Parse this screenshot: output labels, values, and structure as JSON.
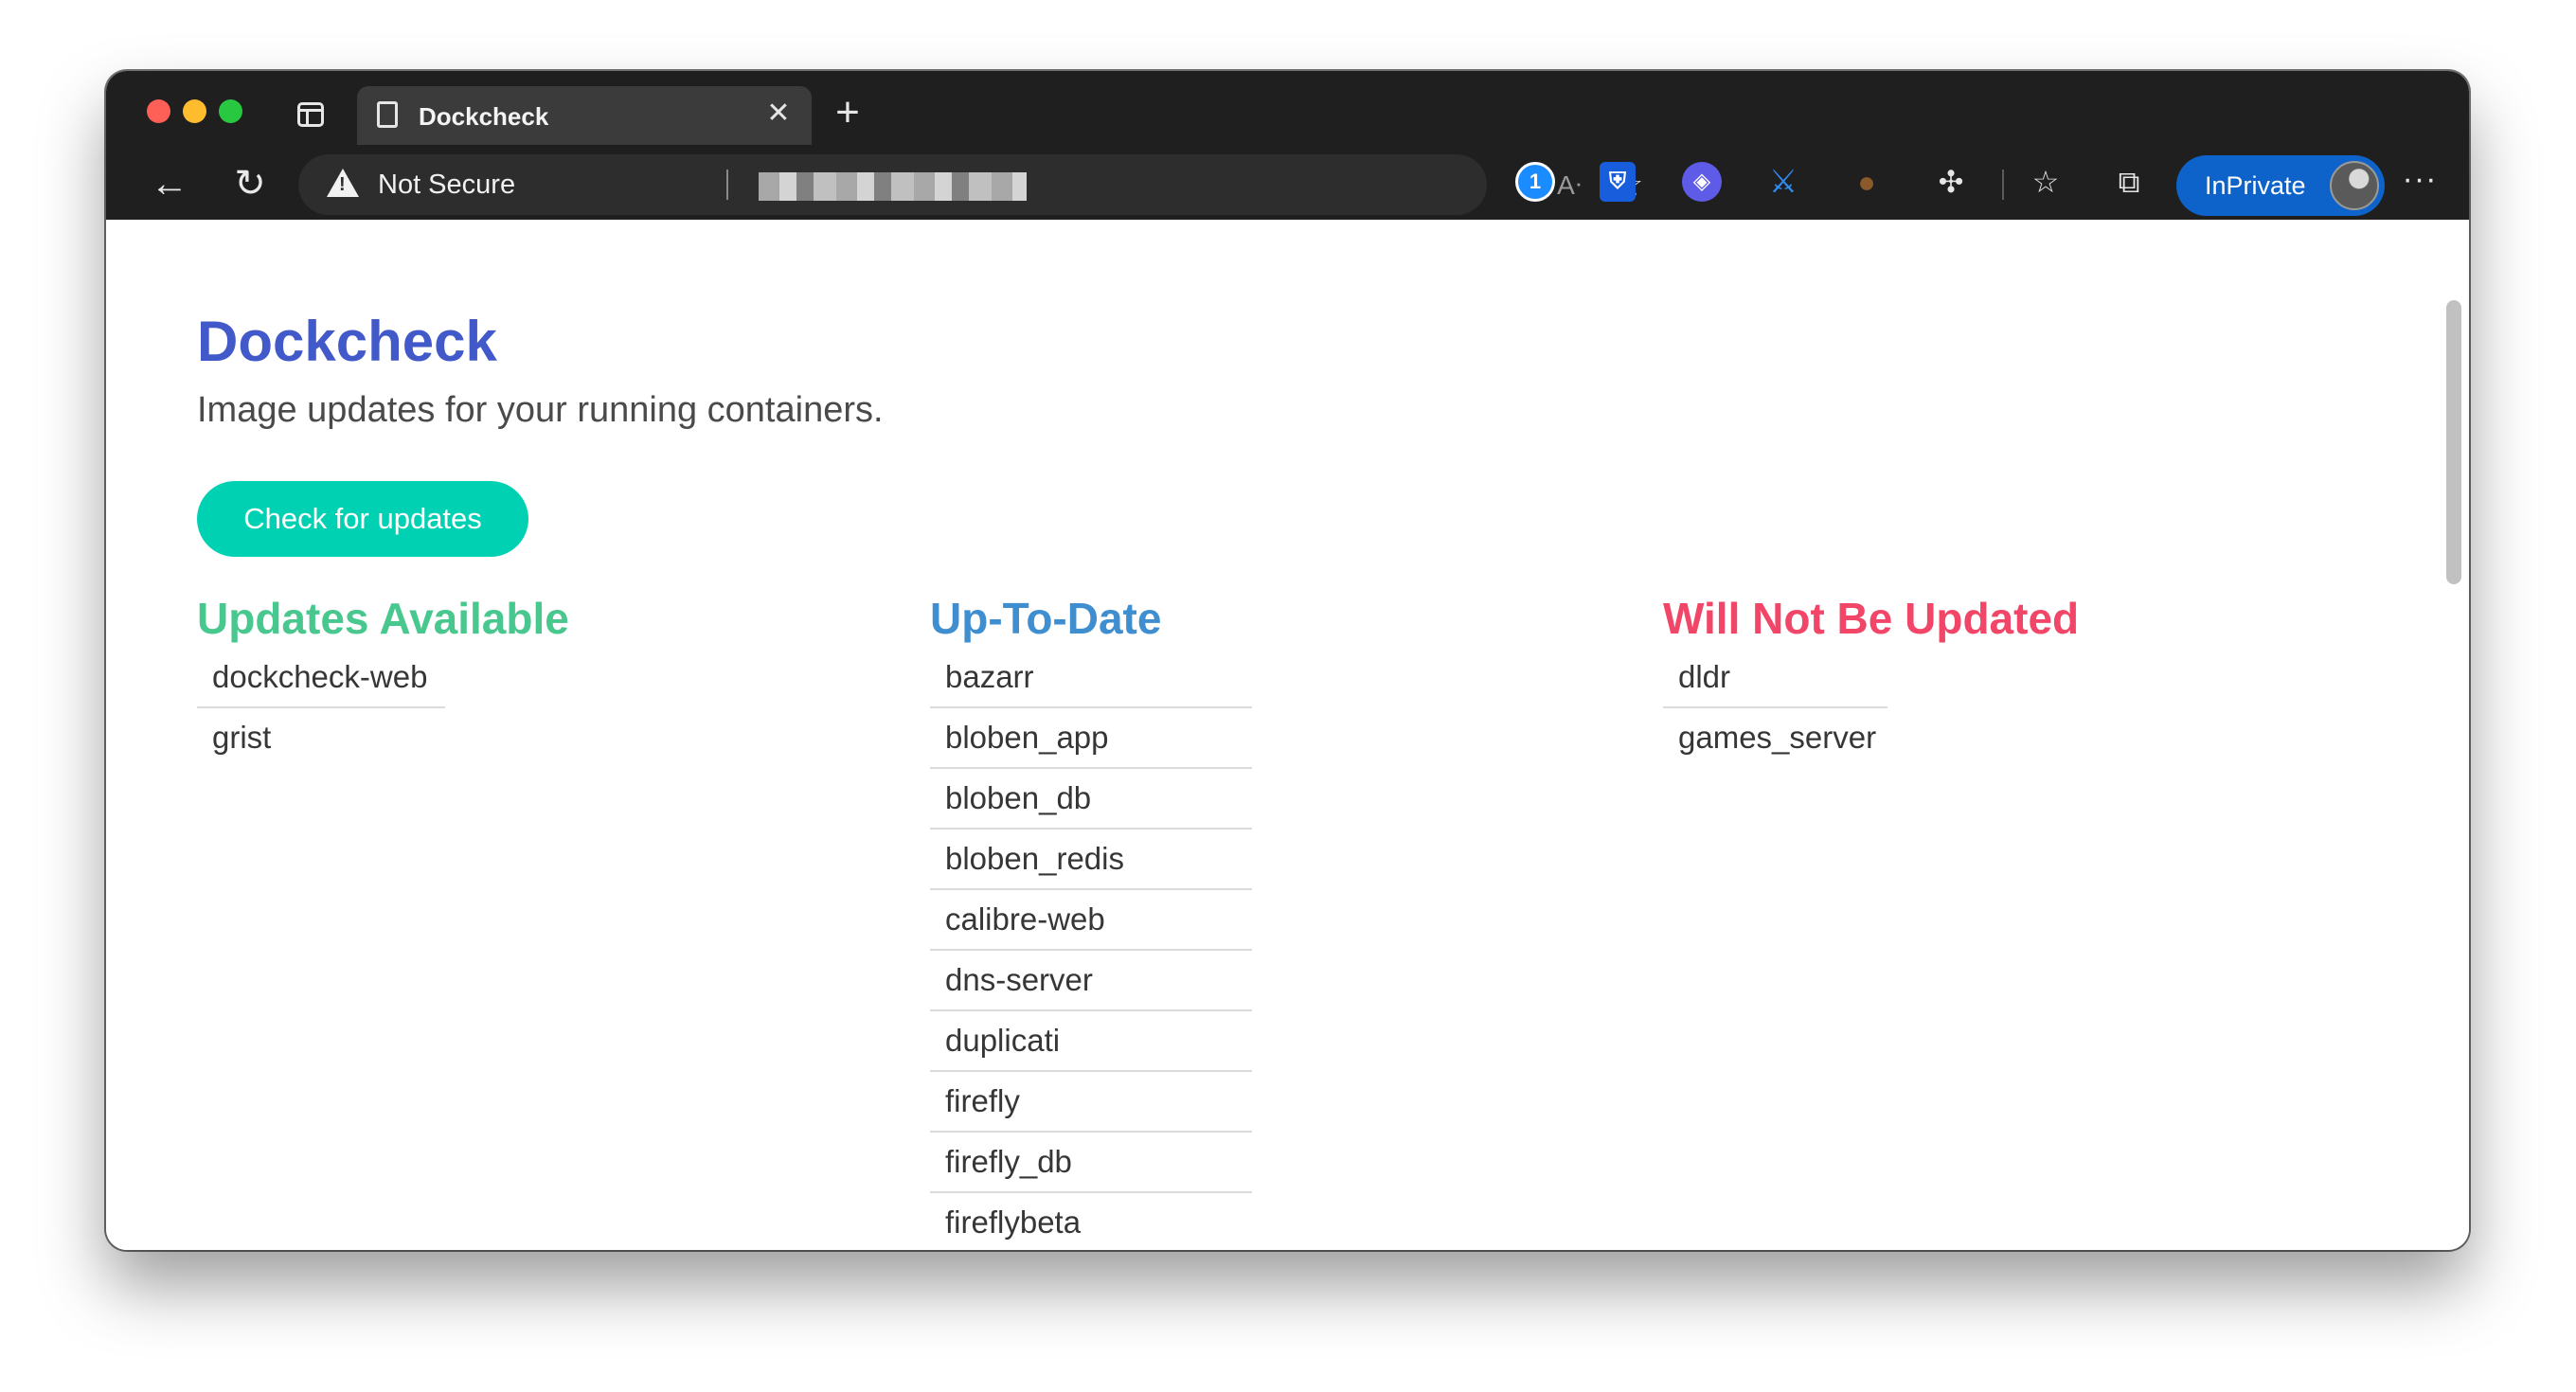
{
  "browser": {
    "tab": {
      "title": "Dockcheck",
      "close_glyph": "✕"
    },
    "new_tab_glyph": "+",
    "nav": {
      "back_glyph": "←",
      "reload_glyph": "↻"
    },
    "omnibox": {
      "security_label": "Not Secure"
    },
    "read_aloud_glyph": "Aᐧ",
    "favorite_glyph": "☆",
    "extensions": {
      "onepassword_glyph": "1",
      "bitwarden_glyph": "⛨",
      "linear_glyph": "◈",
      "sword_glyph": "⚔",
      "cookie_glyph": "●",
      "puzzle_glyph": "✣"
    },
    "favorites_glyph": "☆",
    "collections_glyph": "⧉",
    "inprivate_label": "InPrivate",
    "more_glyph": "···",
    "colors": {
      "inprivate": "#0d63c9",
      "titlebar": "#1f1f20"
    }
  },
  "page": {
    "title": "Dockcheck",
    "subtitle": "Image updates for your running containers.",
    "check_button": "Check for updates",
    "colors": {
      "title": "#4259c9",
      "button": "#00d1b2",
      "updates_available": "#48c78e",
      "up_to_date": "#3e8ed0",
      "will_not_update": "#f14668"
    },
    "columns": {
      "updates_available": {
        "heading": "Updates Available",
        "items": [
          "dockcheck-web",
          "grist"
        ]
      },
      "up_to_date": {
        "heading": "Up-To-Date",
        "items": [
          "bazarr",
          "bloben_app",
          "bloben_db",
          "bloben_redis",
          "calibre-web",
          "dns-server",
          "duplicati",
          "firefly",
          "firefly_db",
          "fireflybeta"
        ]
      },
      "will_not_be_updated": {
        "heading": "Will Not Be Updated",
        "items": [
          "dldr",
          "games_server"
        ]
      }
    }
  }
}
